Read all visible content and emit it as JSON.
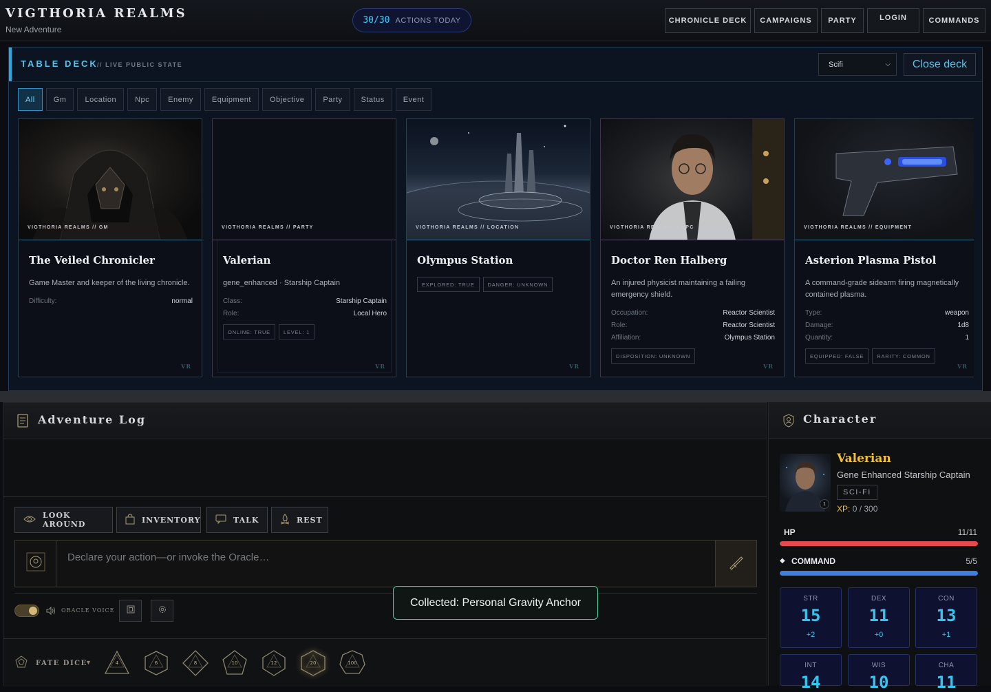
{
  "app": {
    "title": "VIGTHORIA REALMS",
    "subtitle": "New Adventure"
  },
  "actions": {
    "count": "30/30",
    "label": "ACTIONS TODAY"
  },
  "nav": [
    "CHRONICLE DECK",
    "CAMPAIGNS",
    "PARTY",
    "LOGIN",
    "COMMANDS"
  ],
  "deck": {
    "title": "TABLE DECK",
    "subtitle": "// LIVE PUBLIC STATE",
    "theme": "Scifi",
    "close_label": "Close deck",
    "filters": [
      "All",
      "Gm",
      "Location",
      "Npc",
      "Enemy",
      "Equipment",
      "Objective",
      "Party",
      "Status",
      "Event"
    ],
    "active_filter": "All",
    "cards": [
      {
        "tag": "VIGTHORIA REALMS // GM",
        "name": "The Veiled Chronicler",
        "desc": "Game Master and keeper of the living chronicle.",
        "stats": [
          {
            "k": "Difficulty:",
            "v": "normal"
          }
        ],
        "chips": []
      },
      {
        "tag": "VIGTHORIA REALMS // PARTY",
        "name": "Valerian",
        "desc": "gene_enhanced · Starship Captain",
        "stats": [
          {
            "k": "Class:",
            "v": "Starship Captain"
          },
          {
            "k": "Role:",
            "v": "Local Hero"
          }
        ],
        "chips": [
          "ONLINE: TRUE",
          "LEVEL: 1"
        ]
      },
      {
        "tag": "VIGTHORIA REALMS // LOCATION",
        "name": "Olympus Station",
        "desc": "",
        "stats": [],
        "chips": [
          "EXPLORED: TRUE",
          "DANGER: UNKNOWN"
        ]
      },
      {
        "tag": "VIGTHORIA REALMS // NPC",
        "name": "Doctor Ren Halberg",
        "desc": "An injured physicist maintaining a failing emergency shield.",
        "stats": [
          {
            "k": "Occupation:",
            "v": "Reactor Scientist"
          },
          {
            "k": "Role:",
            "v": "Reactor Scientist"
          },
          {
            "k": "Affiliation:",
            "v": "Olympus Station"
          }
        ],
        "chips": [
          "DISPOSITION: UNKNOWN"
        ]
      },
      {
        "tag": "VIGTHORIA REALMS // EQUIPMENT",
        "name": "Asterion Plasma Pistol",
        "desc": "A command-grade sidearm firing magnetically contained plasma.",
        "stats": [
          {
            "k": "Type:",
            "v": "weapon"
          },
          {
            "k": "Damage:",
            "v": "1d8"
          },
          {
            "k": "Quantity:",
            "v": "1"
          }
        ],
        "chips": [
          "EQUIPPED: FALSE",
          "RARITY: COMMON"
        ]
      }
    ],
    "card_mark": "VR"
  },
  "log": {
    "title": "Adventure Log",
    "quick_actions": [
      "LOOK AROUND",
      "INVENTORY",
      "TALK",
      "REST"
    ],
    "placeholder": "Declare your action—or invoke the Oracle…",
    "voice_label": "ORACLE VOICE",
    "dice_label": "FATE DICE",
    "dice": [
      "4",
      "6",
      "8",
      "10",
      "12",
      "20",
      "100"
    ]
  },
  "toast": "Collected: Personal Gravity Anchor",
  "character": {
    "title": "Character",
    "name": "Valerian",
    "subtitle": "Gene Enhanced Starship Captain",
    "genre": "SCI-FI",
    "level": "1",
    "xp_label": "XP:",
    "xp_value": "0 / 300",
    "hp": {
      "label": "HP",
      "value": "11/11",
      "fraction": 1.0,
      "color": "#e5484d"
    },
    "command": {
      "label": "COMMAND",
      "value": "5/5",
      "fraction": 1.0,
      "color": "#3f7fe0"
    },
    "stats": [
      {
        "name": "STR",
        "value": "15",
        "mod": "+2"
      },
      {
        "name": "DEX",
        "value": "11",
        "mod": "+0"
      },
      {
        "name": "CON",
        "value": "13",
        "mod": "+1"
      },
      {
        "name": "INT",
        "value": "14",
        "mod": ""
      },
      {
        "name": "WIS",
        "value": "10",
        "mod": ""
      },
      {
        "name": "CHA",
        "value": "11",
        "mod": ""
      }
    ]
  },
  "colors": {
    "accent": "#58c2ea",
    "gold": "#f2c13a",
    "toast_border": "#3fd49a"
  }
}
